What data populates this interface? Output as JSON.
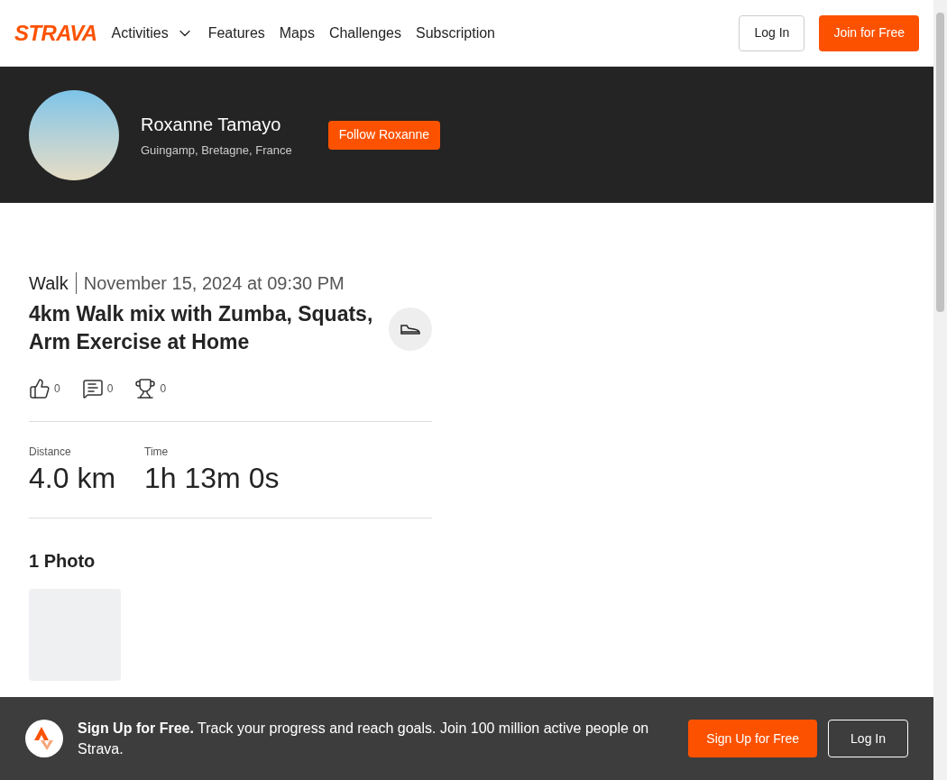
{
  "nav": {
    "brand": "STRAVA",
    "items": [
      {
        "label": "Activities",
        "dropdown": true
      },
      {
        "label": "Features",
        "dropdown": false
      },
      {
        "label": "Maps",
        "dropdown": false
      },
      {
        "label": "Challenges",
        "dropdown": false
      },
      {
        "label": "Subscription",
        "dropdown": false
      }
    ],
    "login": "Log In",
    "join": "Join for Free"
  },
  "athlete": {
    "name": "Roxanne Tamayo",
    "location": "Guingamp, Bretagne, France",
    "follow": "Follow Roxanne"
  },
  "activity": {
    "type": "Walk",
    "date": "November 15, 2024 at 09:30 PM",
    "title": "4km Walk mix with Zumba, Squats, Arm Exercise at Home",
    "reactions": [
      {
        "kind": "kudos",
        "count": "0"
      },
      {
        "kind": "comments",
        "count": "0"
      },
      {
        "kind": "achievements",
        "count": "0"
      }
    ],
    "stats": [
      {
        "label": "Distance",
        "value": "4.0 km"
      },
      {
        "label": "Time",
        "value": "1h 13m 0s"
      }
    ],
    "photos_heading": "1 Photo"
  },
  "banner": {
    "lead": "Sign Up for Free.",
    "text": "Track your progress and reach goals. Join 100 million active people on Strava.",
    "signup": "Sign Up for Free",
    "login": "Log In"
  }
}
